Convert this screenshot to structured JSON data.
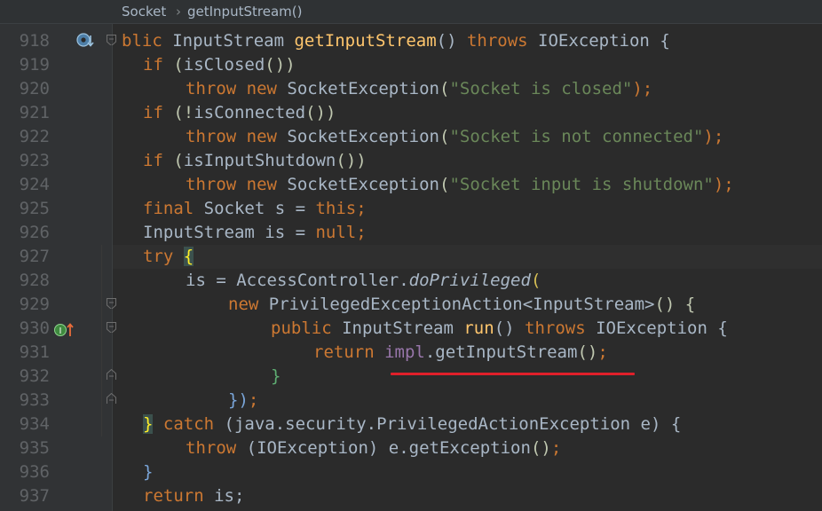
{
  "breadcrumb": {
    "class_name": "Socket",
    "separator": "›",
    "method_name": "getInputStream()"
  },
  "gutter_icons": {
    "line_918": "overrides-method-icon",
    "line_930": "implements-method-icon"
  },
  "colors": {
    "background": "#2b2b2b",
    "gutter": "#313335",
    "keyword": "#cc7832",
    "string": "#6a8759",
    "method": "#ffc66d",
    "field": "#9876aa",
    "annotation_underline": "#e0202a"
  },
  "code": {
    "lines": [
      {
        "num": "918"
      },
      {
        "num": "919"
      },
      {
        "num": "920"
      },
      {
        "num": "921"
      },
      {
        "num": "922"
      },
      {
        "num": "923"
      },
      {
        "num": "924"
      },
      {
        "num": "925"
      },
      {
        "num": "926"
      },
      {
        "num": "927"
      },
      {
        "num": "928"
      },
      {
        "num": "929"
      },
      {
        "num": "930"
      },
      {
        "num": "931"
      },
      {
        "num": "932"
      },
      {
        "num": "933"
      },
      {
        "num": "934"
      },
      {
        "num": "935"
      },
      {
        "num": "936"
      },
      {
        "num": "937"
      }
    ],
    "l918": {
      "a": "blic ",
      "b": "InputStream ",
      "c": "getInputStream",
      "d": "() ",
      "e": "throws ",
      "f": "IOException {"
    },
    "l919": {
      "a": "if ",
      "b": "(",
      "c": "isClosed",
      "d": "()",
      "e": ")"
    },
    "l920": {
      "a": "throw new ",
      "b": "SocketException",
      "c": "(",
      "d": "\"Socket is closed\"",
      "e": ");"
    },
    "l921": {
      "a": "if ",
      "b": "(!",
      "c": "isConnected",
      "d": "()",
      "e": ")"
    },
    "l922": {
      "a": "throw new ",
      "b": "SocketException",
      "c": "(",
      "d": "\"Socket is not connected\"",
      "e": ");"
    },
    "l923": {
      "a": "if ",
      "b": "(",
      "c": "isInputShutdown",
      "d": "()",
      "e": ")"
    },
    "l924": {
      "a": "throw new ",
      "b": "SocketException",
      "c": "(",
      "d": "\"Socket input is shutdown\"",
      "e": ");"
    },
    "l925": {
      "a": "final ",
      "b": "Socket s = ",
      "c": "this",
      "d": ";"
    },
    "l926": {
      "a": "InputStream is = ",
      "b": "null",
      "c": ";"
    },
    "l927": {
      "a": "try ",
      "b": "{"
    },
    "l928": {
      "a": "is = AccessController.",
      "b": "doPrivileged",
      "c": "("
    },
    "l929": {
      "a": "new ",
      "b": "PrivilegedExceptionAction<InputStream>",
      "c": "() {"
    },
    "l930": {
      "a": "public ",
      "b": "InputStream ",
      "c": "run",
      "d": "() ",
      "e": "throws ",
      "f": "IOException {"
    },
    "l931": {
      "a": "return ",
      "b": "impl",
      "c": ".getInputStream",
      "d": "()",
      "e": ";"
    },
    "l932": {
      "a": "}"
    },
    "l933": {
      "a": "})",
      "b": ";"
    },
    "l934": {
      "a": "}",
      "b": " catch ",
      "c": "(java.security.PrivilegedActionException e) {"
    },
    "l935": {
      "a": "throw ",
      "b": "(IOException) e.getException",
      "c": "()",
      "d": ";"
    },
    "l936": {
      "a": "}"
    },
    "l937": {
      "a": "return ",
      "b": "is;"
    }
  }
}
